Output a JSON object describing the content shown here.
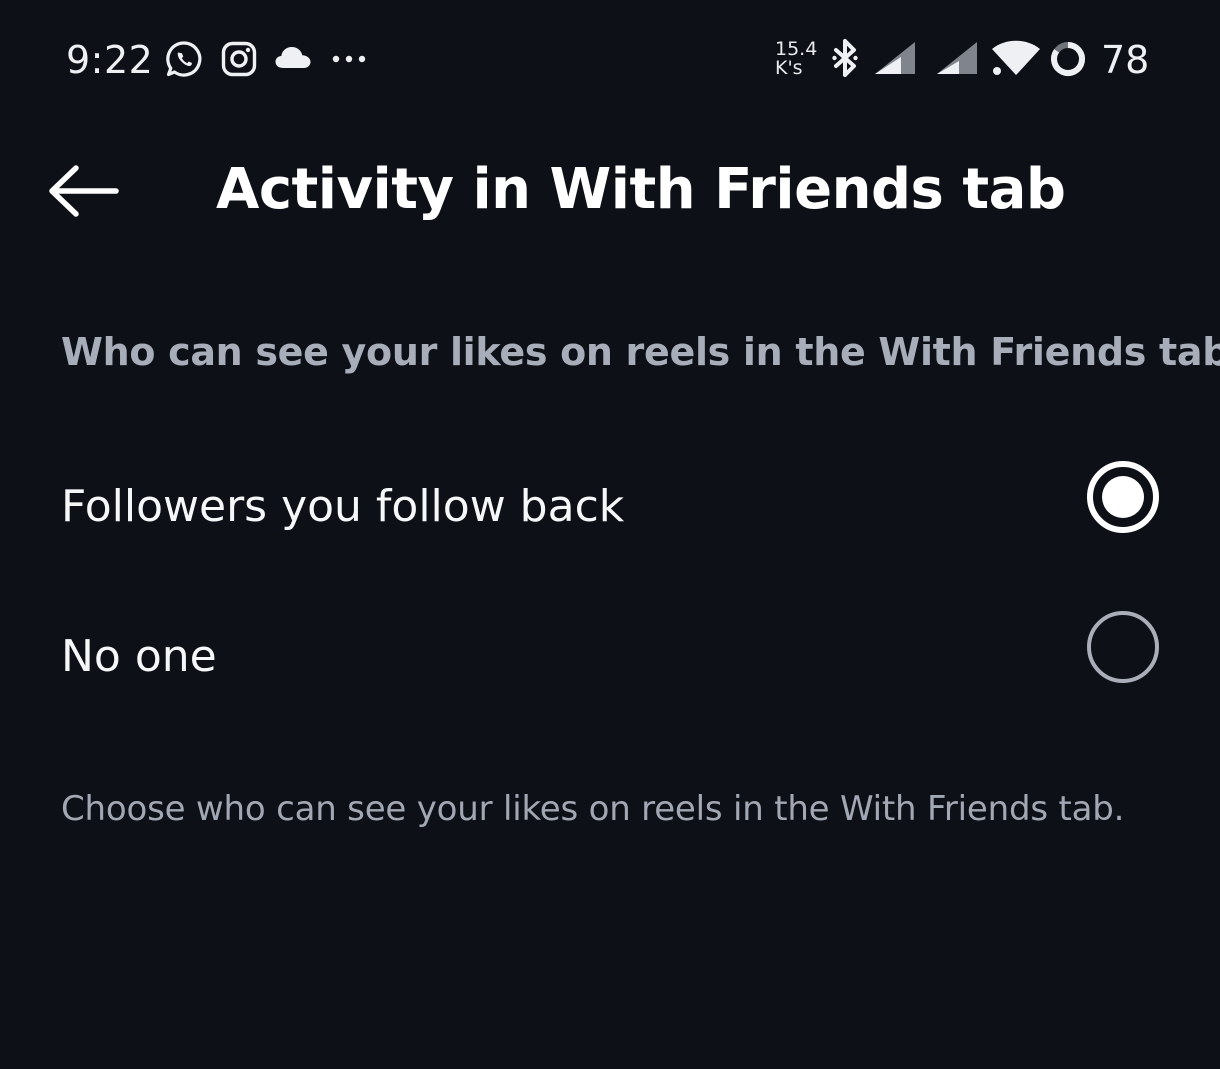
{
  "status_bar": {
    "time": "9:22",
    "icons": [
      "whatsapp-icon",
      "instagram-icon",
      "cloud-icon",
      "more-notifications-icon"
    ],
    "net_speed_value": "15.4",
    "net_speed_unit": "K's",
    "system_icons": [
      "bluetooth-icon",
      "signal-icon",
      "signal-icon",
      "wifi-icon",
      "battery-ring-icon"
    ],
    "battery": "78"
  },
  "header": {
    "back_icon": "arrow-left-icon",
    "title": "Activity in With Friends tab"
  },
  "section": {
    "heading": "Who can see your likes on reels in the With Friends tab"
  },
  "options": [
    {
      "label": "Followers you follow back",
      "selected": true
    },
    {
      "label": "No one",
      "selected": false
    }
  ],
  "footer": {
    "note": "Choose who can see your likes on reels in the With Friends tab."
  },
  "colors": {
    "background": "#0d1016",
    "primary_text": "#ffffff",
    "secondary_text": "#a7adb9",
    "radio_unselected": "#a9aeb8"
  }
}
